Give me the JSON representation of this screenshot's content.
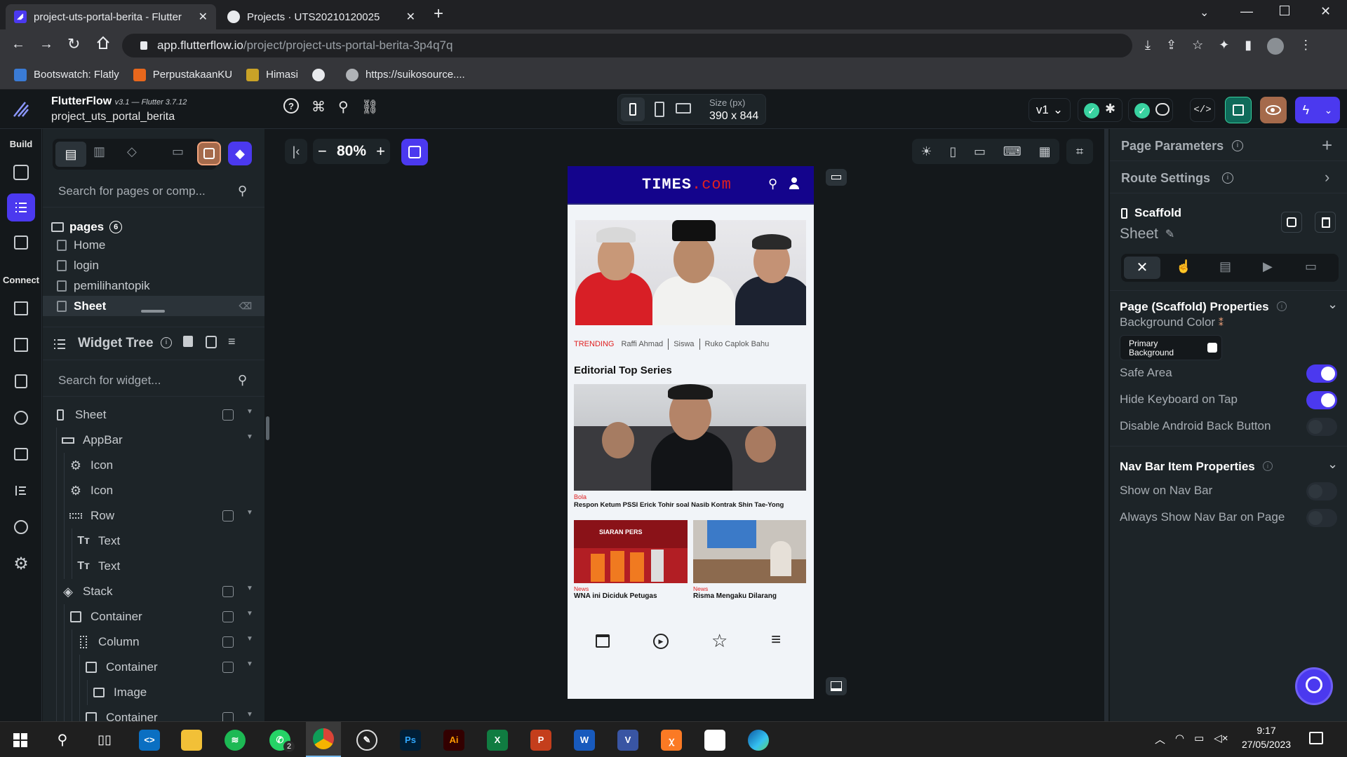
{
  "browser": {
    "tabs": [
      {
        "title": "project-uts-portal-berita - Flutter",
        "active": true
      },
      {
        "title": "Projects · UTS20210120025",
        "active": false
      }
    ],
    "url_host": "app.flutterflow.io",
    "url_path": "/project/project-uts-portal-berita-3p4q7q",
    "bookmarks": [
      "Bootswatch: Flatly",
      "PerpustakaanKU",
      "Himasi",
      "https://suikosource...."
    ]
  },
  "header": {
    "brand": "FlutterFlow",
    "version": "v3.1 — Flutter 3.7.12",
    "project_name": "project_uts_portal_berita",
    "size_label": "Size (px)",
    "size_value": "390 x 844",
    "version_select": "v1"
  },
  "rail": {
    "build_label": "Build",
    "connect_label": "Connect"
  },
  "left_panel": {
    "search_pages_placeholder": "Search for pages or comp...",
    "pages_label": "pages",
    "pages_count": "6",
    "pages": [
      "Home",
      "login",
      "pemilihantopik",
      "Sheet"
    ],
    "widget_tree_title": "Widget Tree",
    "search_widget_placeholder": "Search for widget...",
    "tree": [
      {
        "label": "Sheet",
        "indent": 0,
        "icon": "phone",
        "add": true,
        "caret": true
      },
      {
        "label": "AppBar",
        "indent": 1,
        "icon": "appbar",
        "add": false,
        "caret": true
      },
      {
        "label": "Icon",
        "indent": 2,
        "icon": "gear",
        "add": false,
        "caret": false
      },
      {
        "label": "Icon",
        "indent": 2,
        "icon": "gear",
        "add": false,
        "caret": false
      },
      {
        "label": "Row",
        "indent": 2,
        "icon": "row",
        "add": true,
        "caret": true
      },
      {
        "label": "Text",
        "indent": 3,
        "icon": "text",
        "add": false,
        "caret": false
      },
      {
        "label": "Text",
        "indent": 3,
        "icon": "text",
        "add": false,
        "caret": false
      },
      {
        "label": "Stack",
        "indent": 1,
        "icon": "stack",
        "add": true,
        "caret": true
      },
      {
        "label": "Container",
        "indent": 2,
        "icon": "box",
        "add": true,
        "caret": true
      },
      {
        "label": "Column",
        "indent": 3,
        "icon": "column",
        "add": true,
        "caret": true
      },
      {
        "label": "Container",
        "indent": 4,
        "icon": "box",
        "add": true,
        "caret": true
      },
      {
        "label": "Image",
        "indent": 5,
        "icon": "image",
        "add": false,
        "caret": false
      },
      {
        "label": "Container",
        "indent": 4,
        "icon": "box",
        "add": true,
        "caret": true
      }
    ]
  },
  "canvas": {
    "zoom": "80%"
  },
  "phone": {
    "brand_main": "TIMES",
    "brand_dot": ".com",
    "trending_label": "TRENDING",
    "trending": [
      "Raffi Ahmad",
      "Siswa",
      "Ruko Caplok Bahu"
    ],
    "section_title": "Editorial Top Series",
    "main_tag": "Bola",
    "main_headline": "Respon Ketum PSSI Erick Tohir soal Nasib Kontrak Shin Tae-Yong",
    "card1_tag": "News",
    "card1_title": "WNA ini Diciduk Petugas",
    "card1_banner": "SIARAN PERS",
    "card2_tag": "News",
    "card2_title": "Risma Mengaku Dilarang"
  },
  "right_panel": {
    "page_parameters": "Page Parameters",
    "route_settings": "Route Settings",
    "scaffold_label": "Scaffold",
    "page_name": "Sheet",
    "props_title": "Page (Scaffold) Properties",
    "bg_color_label": "Background Color",
    "bg_color_value": "Primary Background",
    "safe_area": "Safe Area",
    "safe_area_on": true,
    "hide_keyboard": "Hide Keyboard on Tap",
    "hide_keyboard_on": true,
    "disable_back": "Disable Android Back Button",
    "disable_back_on": false,
    "nav_title": "Nav Bar Item Properties",
    "show_nav": "Show on Nav Bar",
    "show_nav_on": false,
    "always_nav": "Always Show Nav Bar on Page",
    "always_nav_on": false
  },
  "taskbar": {
    "time": "9:17",
    "date": "27/05/2023",
    "whatsapp_badge": "2"
  },
  "colors": {
    "accent": "#4b39ef",
    "toggle_on": "#4b39ef",
    "phone_appbar": "#14048c",
    "times_red": "#e02020",
    "success": "#39d2a0"
  }
}
